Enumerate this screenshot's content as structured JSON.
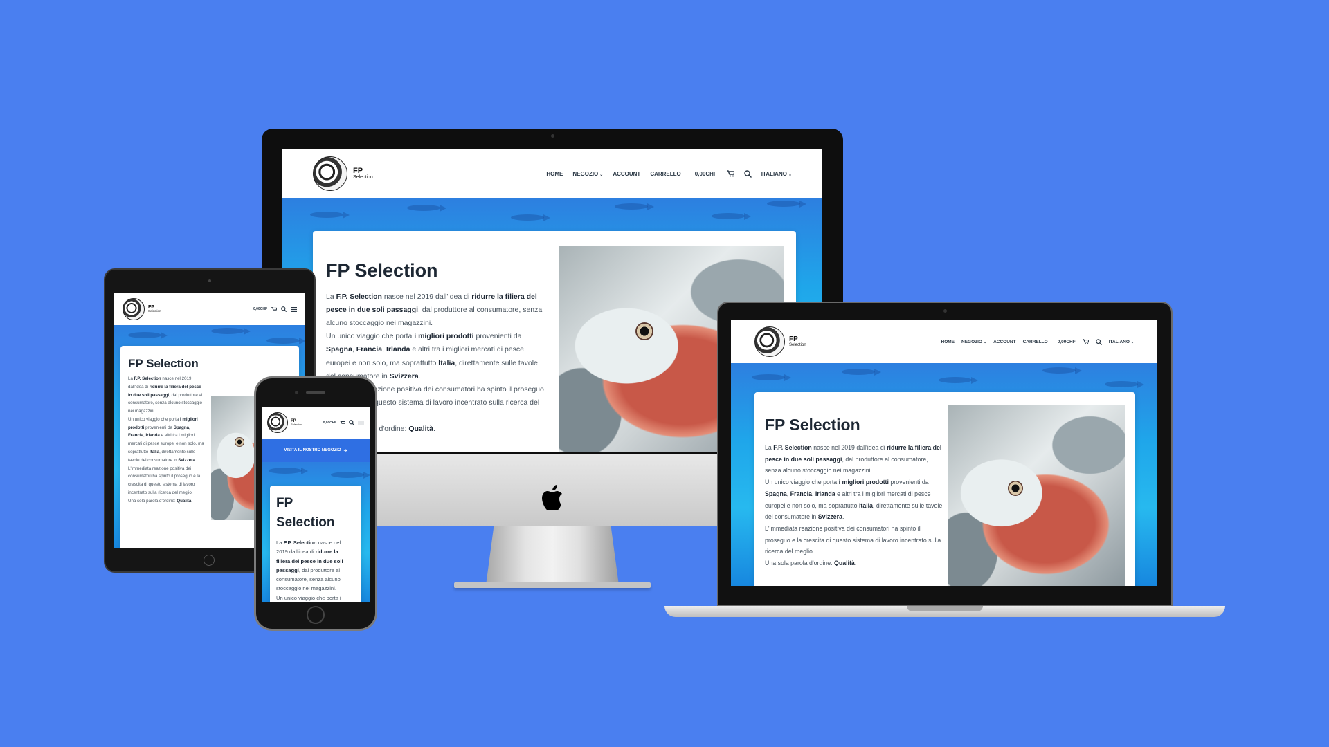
{
  "site": {
    "logo": {
      "title": "FP",
      "subtitle": "Selection"
    },
    "nav": {
      "home": "HOME",
      "shop": "NEGOZIO",
      "account": "ACCOUNT",
      "cart": "CARRELLO",
      "price": "0,00CHF",
      "language": "ITALIANO"
    },
    "mobile_price": "0,00CHF",
    "visit_shop": "VISITA IL NOSTRO NEGOZIO",
    "page_title": "FP Selection",
    "body": {
      "s1_a": "La ",
      "s1_b": "F.P. Selection",
      "s1_c": " nasce nel 2019 dall'idea di ",
      "s1_d": "ridurre la filiera del pesce in due soli passaggi",
      "s1_e": ", dal produttore al consumatore, senza alcuno stoccaggio nei magazzini.",
      "s2_a": "Un unico viaggio che porta ",
      "s2_b": "i migliori prodotti",
      "s2_c": " provenienti da ",
      "s2_d": "Spagna",
      "s2_e": ", ",
      "s2_f": "Francia",
      "s2_g": ", ",
      "s2_h": "Irlanda",
      "s2_i": " e altri tra i migliori mercati di pesce europei e non solo, ma soprattutto ",
      "s2_j": "Italia",
      "s2_k": ", direttamente sulle tavole del consumatore in ",
      "s2_l": "Svizzera",
      "s2_m": ".",
      "s3": "L'immediata reazione positiva dei consumatori ha spinto il proseguo e la crescita di questo sistema di lavoro incentrato sulla ricerca del meglio.",
      "s4_a": "Una sola parola d'ordine: ",
      "s4_b": "Qualità",
      "s4_c": "."
    }
  },
  "colors": {
    "background": "#4a7ff0",
    "visit_bar": "#2f6fe3"
  },
  "icons": [
    "cart-icon",
    "search-icon",
    "menu-icon",
    "apple-logo-icon",
    "arrow-right-icon"
  ]
}
